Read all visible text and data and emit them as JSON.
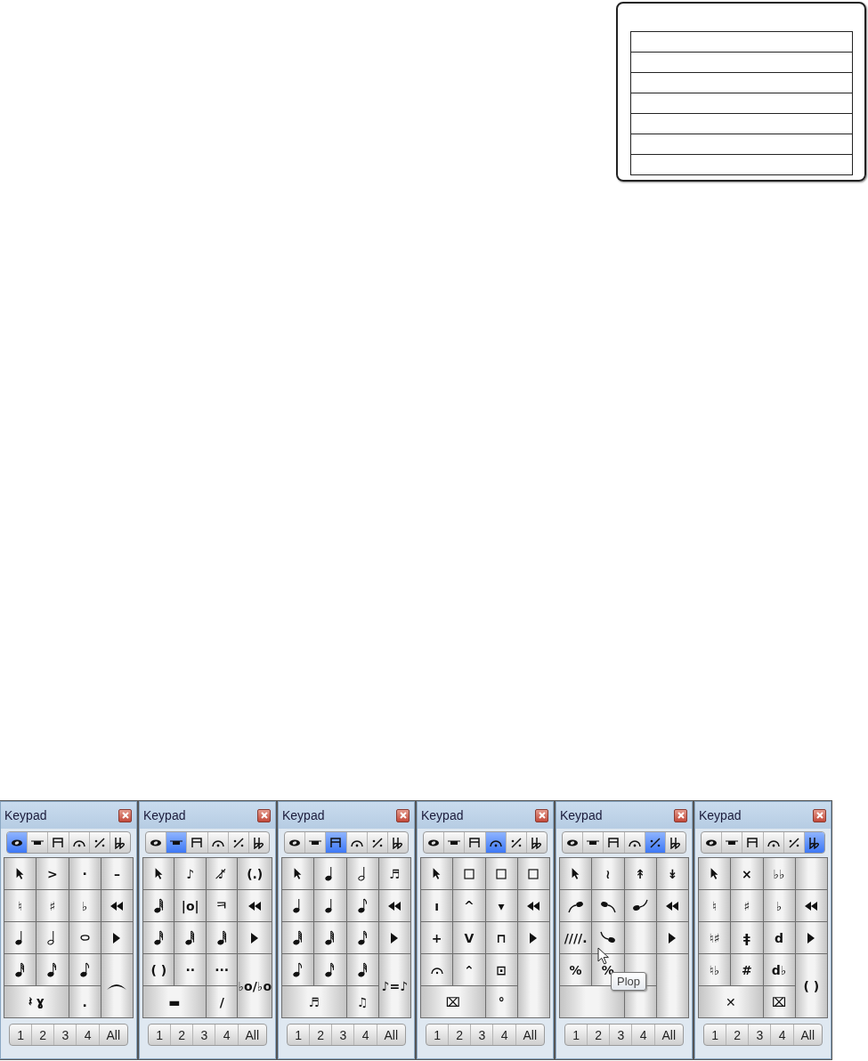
{
  "form": {
    "rows": [
      {
        "kind": "line"
      },
      {
        "kind": "line"
      },
      {
        "kind": "line"
      },
      {
        "kind": "line"
      },
      {
        "kind": "line"
      },
      {
        "kind": "line"
      },
      {
        "kind": "line"
      }
    ]
  },
  "keypads": [
    {
      "title": "Keypad",
      "tabs": [
        {
          "kind": "note",
          "selected": true
        },
        {
          "kind": "rest",
          "selected": false
        },
        {
          "kind": "beam",
          "selected": false
        },
        {
          "kind": "fermata",
          "selected": false
        },
        {
          "kind": "percent",
          "selected": false
        },
        {
          "kind": "flat",
          "selected": false
        }
      ],
      "keys": [
        {
          "kind": "pointer"
        },
        {
          "kind": "glyph",
          "text": ">"
        },
        {
          "kind": "glyph",
          "text": "·"
        },
        {
          "kind": "glyph",
          "text": "–"
        },
        {
          "kind": "glyph",
          "text": "♮"
        },
        {
          "kind": "glyph",
          "text": "♯"
        },
        {
          "kind": "glyph",
          "text": "♭"
        },
        {
          "kind": "rewind"
        },
        {
          "kind": "quarter-note"
        },
        {
          "kind": "half-note"
        },
        {
          "kind": "whole-note"
        },
        {
          "kind": "play"
        },
        {
          "kind": "thirty-second-note"
        },
        {
          "kind": "sixteenth-note"
        },
        {
          "kind": "eighth-note"
        },
        {
          "kind": "slur"
        },
        {
          "kind": "glyph",
          "text": "𝄽 ɣ"
        },
        {
          "kind": "glyph",
          "text": "."
        }
      ],
      "pages": [
        {
          "label": "1",
          "selected": false
        },
        {
          "label": "2",
          "selected": false
        },
        {
          "label": "3",
          "selected": false
        },
        {
          "label": "4",
          "selected": false
        },
        {
          "label": "All",
          "selected": false
        }
      ]
    },
    {
      "title": "Keypad",
      "tabs": [
        {
          "kind": "note",
          "selected": false
        },
        {
          "kind": "rest",
          "selected": true
        },
        {
          "kind": "beam",
          "selected": false
        },
        {
          "kind": "fermata",
          "selected": false
        },
        {
          "kind": "percent",
          "selected": false
        },
        {
          "kind": "flat",
          "selected": false
        }
      ],
      "keys": [
        {
          "kind": "pointer"
        },
        {
          "kind": "glyph",
          "text": "♪"
        },
        {
          "kind": "glyph",
          "text": "♪̸"
        },
        {
          "kind": "glyph",
          "text": "(.)"
        },
        {
          "kind": "sixty-fourth-note"
        },
        {
          "kind": "glyph",
          "text": "|o|"
        },
        {
          "kind": "glyph",
          "text": "ㅋ"
        },
        {
          "kind": "rewind"
        },
        {
          "kind": "thirty-second-note"
        },
        {
          "kind": "sixty-fourth-note"
        },
        {
          "kind": "sixty-fourth-note"
        },
        {
          "kind": "play"
        },
        {
          "kind": "glyph",
          "text": "( )"
        },
        {
          "kind": "glyph",
          "text": "··"
        },
        {
          "kind": "glyph",
          "text": "···"
        },
        {
          "kind": "glyph",
          "text": "♭o/♭o"
        },
        {
          "kind": "glyph",
          "text": "▬"
        },
        {
          "kind": "glyph",
          "text": "/"
        }
      ],
      "pages": [
        {
          "label": "1",
          "selected": false
        },
        {
          "label": "2",
          "selected": false
        },
        {
          "label": "3",
          "selected": false
        },
        {
          "label": "4",
          "selected": false
        },
        {
          "label": "All",
          "selected": false
        }
      ]
    },
    {
      "title": "Keypad",
      "tabs": [
        {
          "kind": "note",
          "selected": false
        },
        {
          "kind": "rest",
          "selected": false
        },
        {
          "kind": "beam",
          "selected": true
        },
        {
          "kind": "fermata",
          "selected": false
        },
        {
          "kind": "percent",
          "selected": false
        },
        {
          "kind": "flat",
          "selected": false
        }
      ],
      "keys": [
        {
          "kind": "pointer"
        },
        {
          "kind": "quarter-note"
        },
        {
          "kind": "half-note"
        },
        {
          "kind": "glyph",
          "text": "♬"
        },
        {
          "kind": "quarter-note"
        },
        {
          "kind": "quarter-note"
        },
        {
          "kind": "eighth-note"
        },
        {
          "kind": "rewind"
        },
        {
          "kind": "sixty-fourth-note"
        },
        {
          "kind": "sixty-fourth-note"
        },
        {
          "kind": "sixteenth-note"
        },
        {
          "kind": "play"
        },
        {
          "kind": "eighth-note"
        },
        {
          "kind": "sixteenth-note"
        },
        {
          "kind": "thirty-second-note"
        },
        {
          "kind": "glyph",
          "text": "♪=♪"
        },
        {
          "kind": "glyph",
          "text": "♬"
        },
        {
          "kind": "glyph",
          "text": "♫"
        }
      ],
      "pages": [
        {
          "label": "1",
          "selected": false
        },
        {
          "label": "2",
          "selected": false
        },
        {
          "label": "3",
          "selected": false
        },
        {
          "label": "4",
          "selected": false
        },
        {
          "label": "All",
          "selected": false
        }
      ]
    },
    {
      "title": "Keypad",
      "tabs": [
        {
          "kind": "note",
          "selected": false
        },
        {
          "kind": "rest",
          "selected": false
        },
        {
          "kind": "beam",
          "selected": false
        },
        {
          "kind": "fermata",
          "selected": true
        },
        {
          "kind": "percent",
          "selected": false
        },
        {
          "kind": "flat",
          "selected": false
        }
      ],
      "keys": [
        {
          "kind": "pointer"
        },
        {
          "kind": "square"
        },
        {
          "kind": "square"
        },
        {
          "kind": "square"
        },
        {
          "kind": "glyph",
          "text": "ı"
        },
        {
          "kind": "glyph",
          "text": "^"
        },
        {
          "kind": "glyph",
          "text": "▾"
        },
        {
          "kind": "rewind"
        },
        {
          "kind": "glyph",
          "text": "+"
        },
        {
          "kind": "glyph",
          "text": "V"
        },
        {
          "kind": "glyph",
          "text": "⊓"
        },
        {
          "kind": "play"
        },
        {
          "kind": "fermata"
        },
        {
          "kind": "glyph",
          "text": "⌃"
        },
        {
          "kind": "glyph",
          "text": "⊡"
        },
        {
          "kind": "blank"
        },
        {
          "kind": "glyph",
          "text": "⌧"
        },
        {
          "kind": "glyph",
          "text": "°"
        }
      ],
      "pages": [
        {
          "label": "1",
          "selected": false
        },
        {
          "label": "2",
          "selected": false
        },
        {
          "label": "3",
          "selected": false
        },
        {
          "label": "4",
          "selected": false
        },
        {
          "label": "All",
          "selected": false
        }
      ]
    },
    {
      "title": "Keypad",
      "tabs": [
        {
          "kind": "note",
          "selected": false
        },
        {
          "kind": "rest",
          "selected": false
        },
        {
          "kind": "beam",
          "selected": false
        },
        {
          "kind": "fermata",
          "selected": false
        },
        {
          "kind": "percent",
          "selected": true
        },
        {
          "kind": "flat",
          "selected": false
        }
      ],
      "keys": [
        {
          "kind": "pointer"
        },
        {
          "kind": "glyph",
          "text": "≀"
        },
        {
          "kind": "glyph",
          "text": "↟"
        },
        {
          "kind": "glyph",
          "text": "↡"
        },
        {
          "kind": "scoop-rise"
        },
        {
          "kind": "scoop-fall"
        },
        {
          "kind": "scoop-lift"
        },
        {
          "kind": "rewind"
        },
        {
          "kind": "glyph",
          "text": "////."
        },
        {
          "kind": "scoop-drop"
        },
        {
          "kind": "blank"
        },
        {
          "kind": "play"
        },
        {
          "kind": "glyph",
          "text": "%"
        },
        {
          "kind": "glyph",
          "text": "%"
        },
        {
          "kind": "blank"
        },
        {
          "kind": "blank"
        },
        {
          "kind": "blank"
        },
        {
          "kind": "blank"
        }
      ],
      "tooltip": "Plop",
      "pages": [
        {
          "label": "1",
          "selected": false
        },
        {
          "label": "2",
          "selected": false
        },
        {
          "label": "3",
          "selected": false
        },
        {
          "label": "4",
          "selected": false
        },
        {
          "label": "All",
          "selected": false
        }
      ]
    },
    {
      "title": "Keypad",
      "tabs": [
        {
          "kind": "note",
          "selected": false
        },
        {
          "kind": "rest",
          "selected": false
        },
        {
          "kind": "beam",
          "selected": false
        },
        {
          "kind": "fermata",
          "selected": false
        },
        {
          "kind": "percent",
          "selected": false
        },
        {
          "kind": "flat",
          "selected": true
        }
      ],
      "keys": [
        {
          "kind": "pointer"
        },
        {
          "kind": "glyph",
          "text": "×"
        },
        {
          "kind": "glyph",
          "text": "♭♭"
        },
        {
          "kind": "blank"
        },
        {
          "kind": "glyph",
          "text": "♮"
        },
        {
          "kind": "glyph",
          "text": "♯"
        },
        {
          "kind": "glyph",
          "text": "♭"
        },
        {
          "kind": "rewind"
        },
        {
          "kind": "glyph",
          "text": "♮♯"
        },
        {
          "kind": "glyph",
          "text": "ǂ"
        },
        {
          "kind": "glyph",
          "text": "d"
        },
        {
          "kind": "play"
        },
        {
          "kind": "glyph",
          "text": "♮♭"
        },
        {
          "kind": "glyph",
          "text": "#"
        },
        {
          "kind": "glyph",
          "text": "d♭"
        },
        {
          "kind": "glyph",
          "text": "( )"
        },
        {
          "kind": "glyph",
          "text": "✕"
        },
        {
          "kind": "glyph",
          "text": "⌧"
        }
      ],
      "pages": [
        {
          "label": "1",
          "selected": false
        },
        {
          "label": "2",
          "selected": false
        },
        {
          "label": "3",
          "selected": false
        },
        {
          "label": "4",
          "selected": false
        },
        {
          "label": "All",
          "selected": false
        }
      ]
    }
  ]
}
